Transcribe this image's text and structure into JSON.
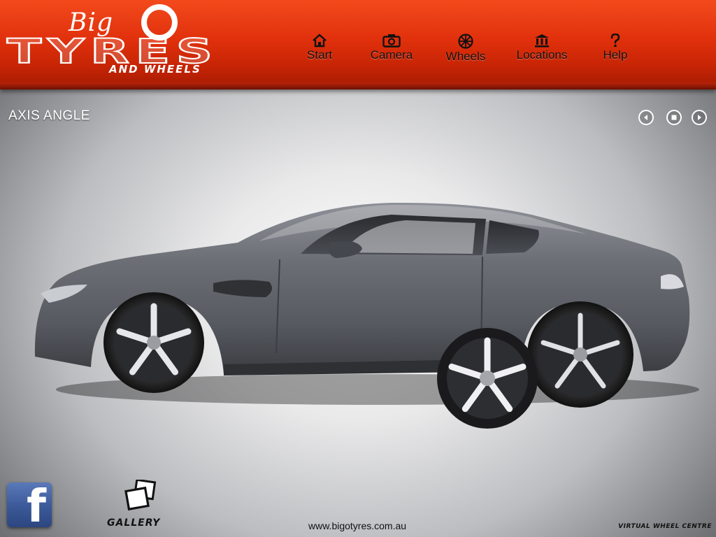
{
  "brand": {
    "line1": "Big",
    "line2": "TYRES",
    "line3": "AND WHEELS"
  },
  "nav": [
    {
      "label": "Start",
      "icon": "home-icon"
    },
    {
      "label": "Camera",
      "icon": "camera-icon"
    },
    {
      "label": "Wheels",
      "icon": "wheel-icon"
    },
    {
      "label": "Locations",
      "icon": "building-icon"
    },
    {
      "label": "Help",
      "icon": "question-icon"
    }
  ],
  "main": {
    "title": "AXIS ANGLE",
    "controls": [
      "prev-icon",
      "stop-icon",
      "next-icon"
    ]
  },
  "footer": {
    "facebook_icon": "facebook-icon",
    "gallery_label": "GALLERY",
    "url": "www.bigotyres.com.au",
    "tagline": "VIRTUAL WHEEL CENTRE"
  },
  "colors": {
    "header_top": "#f34a1c",
    "header_bottom": "#a31a02",
    "facebook_blue": "#3b5998"
  }
}
